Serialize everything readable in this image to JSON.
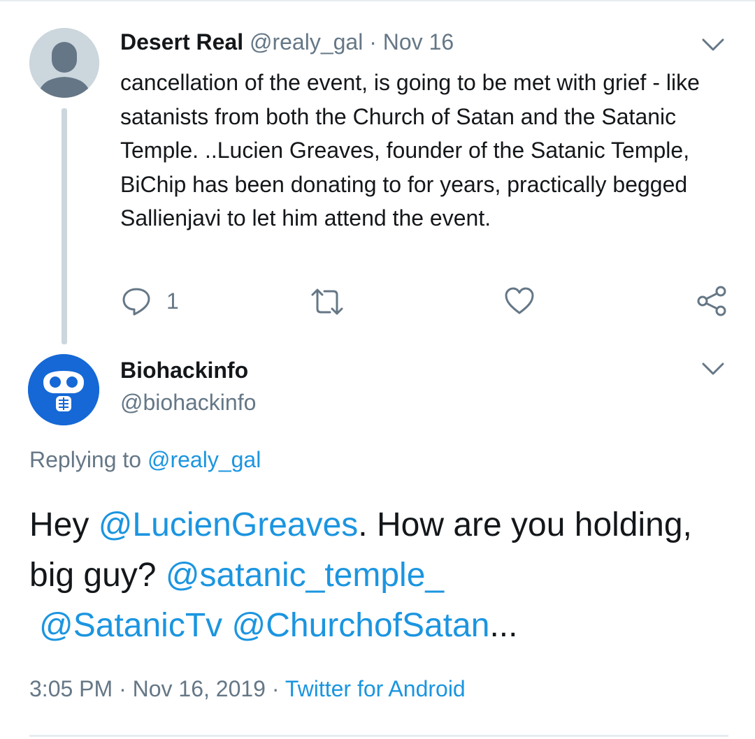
{
  "parent_tweet": {
    "display_name": "Desert Real",
    "handle": "@realy_gal",
    "separator": "·",
    "date": "Nov 16",
    "text": "cancellation of the event, is going to be met with grief - like satanists from both the Church of Satan and the Satanic Temple. ..Lucien Greaves, founder of the Satanic Temple, BiChip has been donating to for years, practically begged Sallienjavi to let him attend the event.",
    "reply_count": "1",
    "icons": [
      "default-avatar",
      "chevron-down-icon",
      "reply-icon",
      "retweet-icon",
      "like-icon",
      "share-icon"
    ]
  },
  "main_tweet": {
    "display_name": "Biohackinfo",
    "handle": "@biohackinfo",
    "replying_prefix": "Replying to ",
    "replying_to": "@realy_gal",
    "text_parts": {
      "p1": "Hey ",
      "m1": "@LucienGreaves",
      "p2": ". How are you holding, big guy? ",
      "m2": "@satanic_temple_",
      "m3": "@SatanicTv",
      "m4": "@ChurchofSatan",
      "p3": "..."
    },
    "time": "3:05 PM",
    "separator": " · ",
    "full_date": "Nov 16, 2019",
    "source": "Twitter for Android"
  },
  "colors": {
    "text": "#14171a",
    "muted": "#657786",
    "link": "#1b95e0",
    "avatar_blue": "#1568d6",
    "thread_line": "#ccd6dd"
  }
}
